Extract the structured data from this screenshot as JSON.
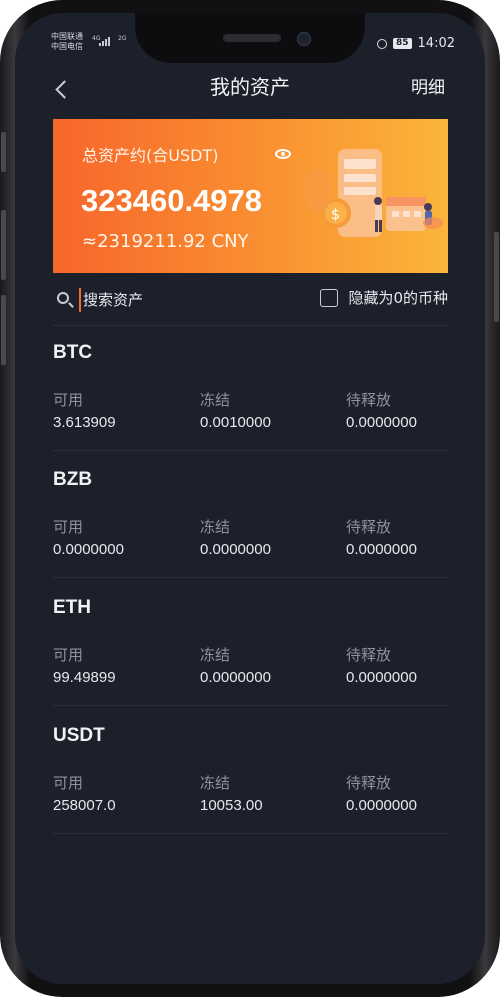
{
  "status_bar": {
    "carrier_1": "中国联通",
    "carrier_2": "中国电信",
    "net_1": "4G",
    "net_2": "2G",
    "battery": "85",
    "time": "14:02"
  },
  "nav": {
    "title": "我的资产",
    "detail_label": "明细"
  },
  "summary": {
    "label": "总资产约(合USDT)",
    "total_usdt": "323460.4978",
    "total_cny": "≈2319211.92 CNY"
  },
  "search": {
    "placeholder": "搜索资产",
    "hide_zero_label": "隐藏为0的币种"
  },
  "columns": {
    "available": "可用",
    "frozen": "冻结",
    "pending": "待释放"
  },
  "assets": [
    {
      "name": "BTC",
      "available": "3.613909",
      "frozen": "0.0010000",
      "pending": "0.0000000"
    },
    {
      "name": "BZB",
      "available": "0.0000000",
      "frozen": "0.0000000",
      "pending": "0.0000000"
    },
    {
      "name": "ETH",
      "available": "99.49899",
      "frozen": "0.0000000",
      "pending": "0.0000000"
    },
    {
      "name": "USDT",
      "available": "258007.0",
      "frozen": "10053.00",
      "pending": "0.0000000"
    }
  ],
  "colors": {
    "background": "#1c202b",
    "card_gradient_start": "#f7662b",
    "card_gradient_end": "#fbb53a",
    "divider": "#2a2f3b",
    "muted_text": "#8d929e"
  }
}
